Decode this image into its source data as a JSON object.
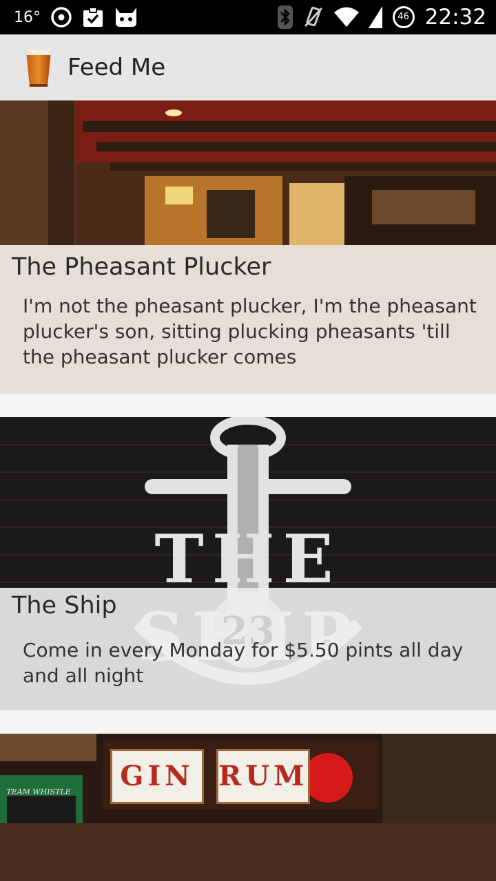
{
  "status_bar": {
    "temperature": "16°",
    "time": "22:32",
    "battery_level": "46",
    "left_icons": [
      "sync-icon",
      "clipboard-check-icon",
      "android-debug-icon"
    ],
    "right_icons": [
      "bluetooth-icon",
      "vibrate-icon",
      "wifi-icon",
      "cell-signal-icon",
      "battery-icon"
    ]
  },
  "action_bar": {
    "title": "Feed Me",
    "icon": "beer-glass-icon"
  },
  "feed": [
    {
      "title": "The Pheasant Plucker",
      "description": "I'm not the pheasant plucker, I'm the pheasant plucker's son, sitting plucking pheasants 'till the pheasant plucker comes",
      "image": "pub-interior-photo"
    },
    {
      "title": "The Ship",
      "description": "Come in every Monday for $5.50 pints all day and all night",
      "image": "the-ship-anchor-logo",
      "logo_text": "THE SHIP",
      "logo_number": "23"
    },
    {
      "title": "",
      "description": "",
      "image": "bar-with-gin-rum-signs",
      "sign_left": "GIN",
      "sign_right": "RUM",
      "board_text": "TEAM WHISTLE"
    }
  ]
}
